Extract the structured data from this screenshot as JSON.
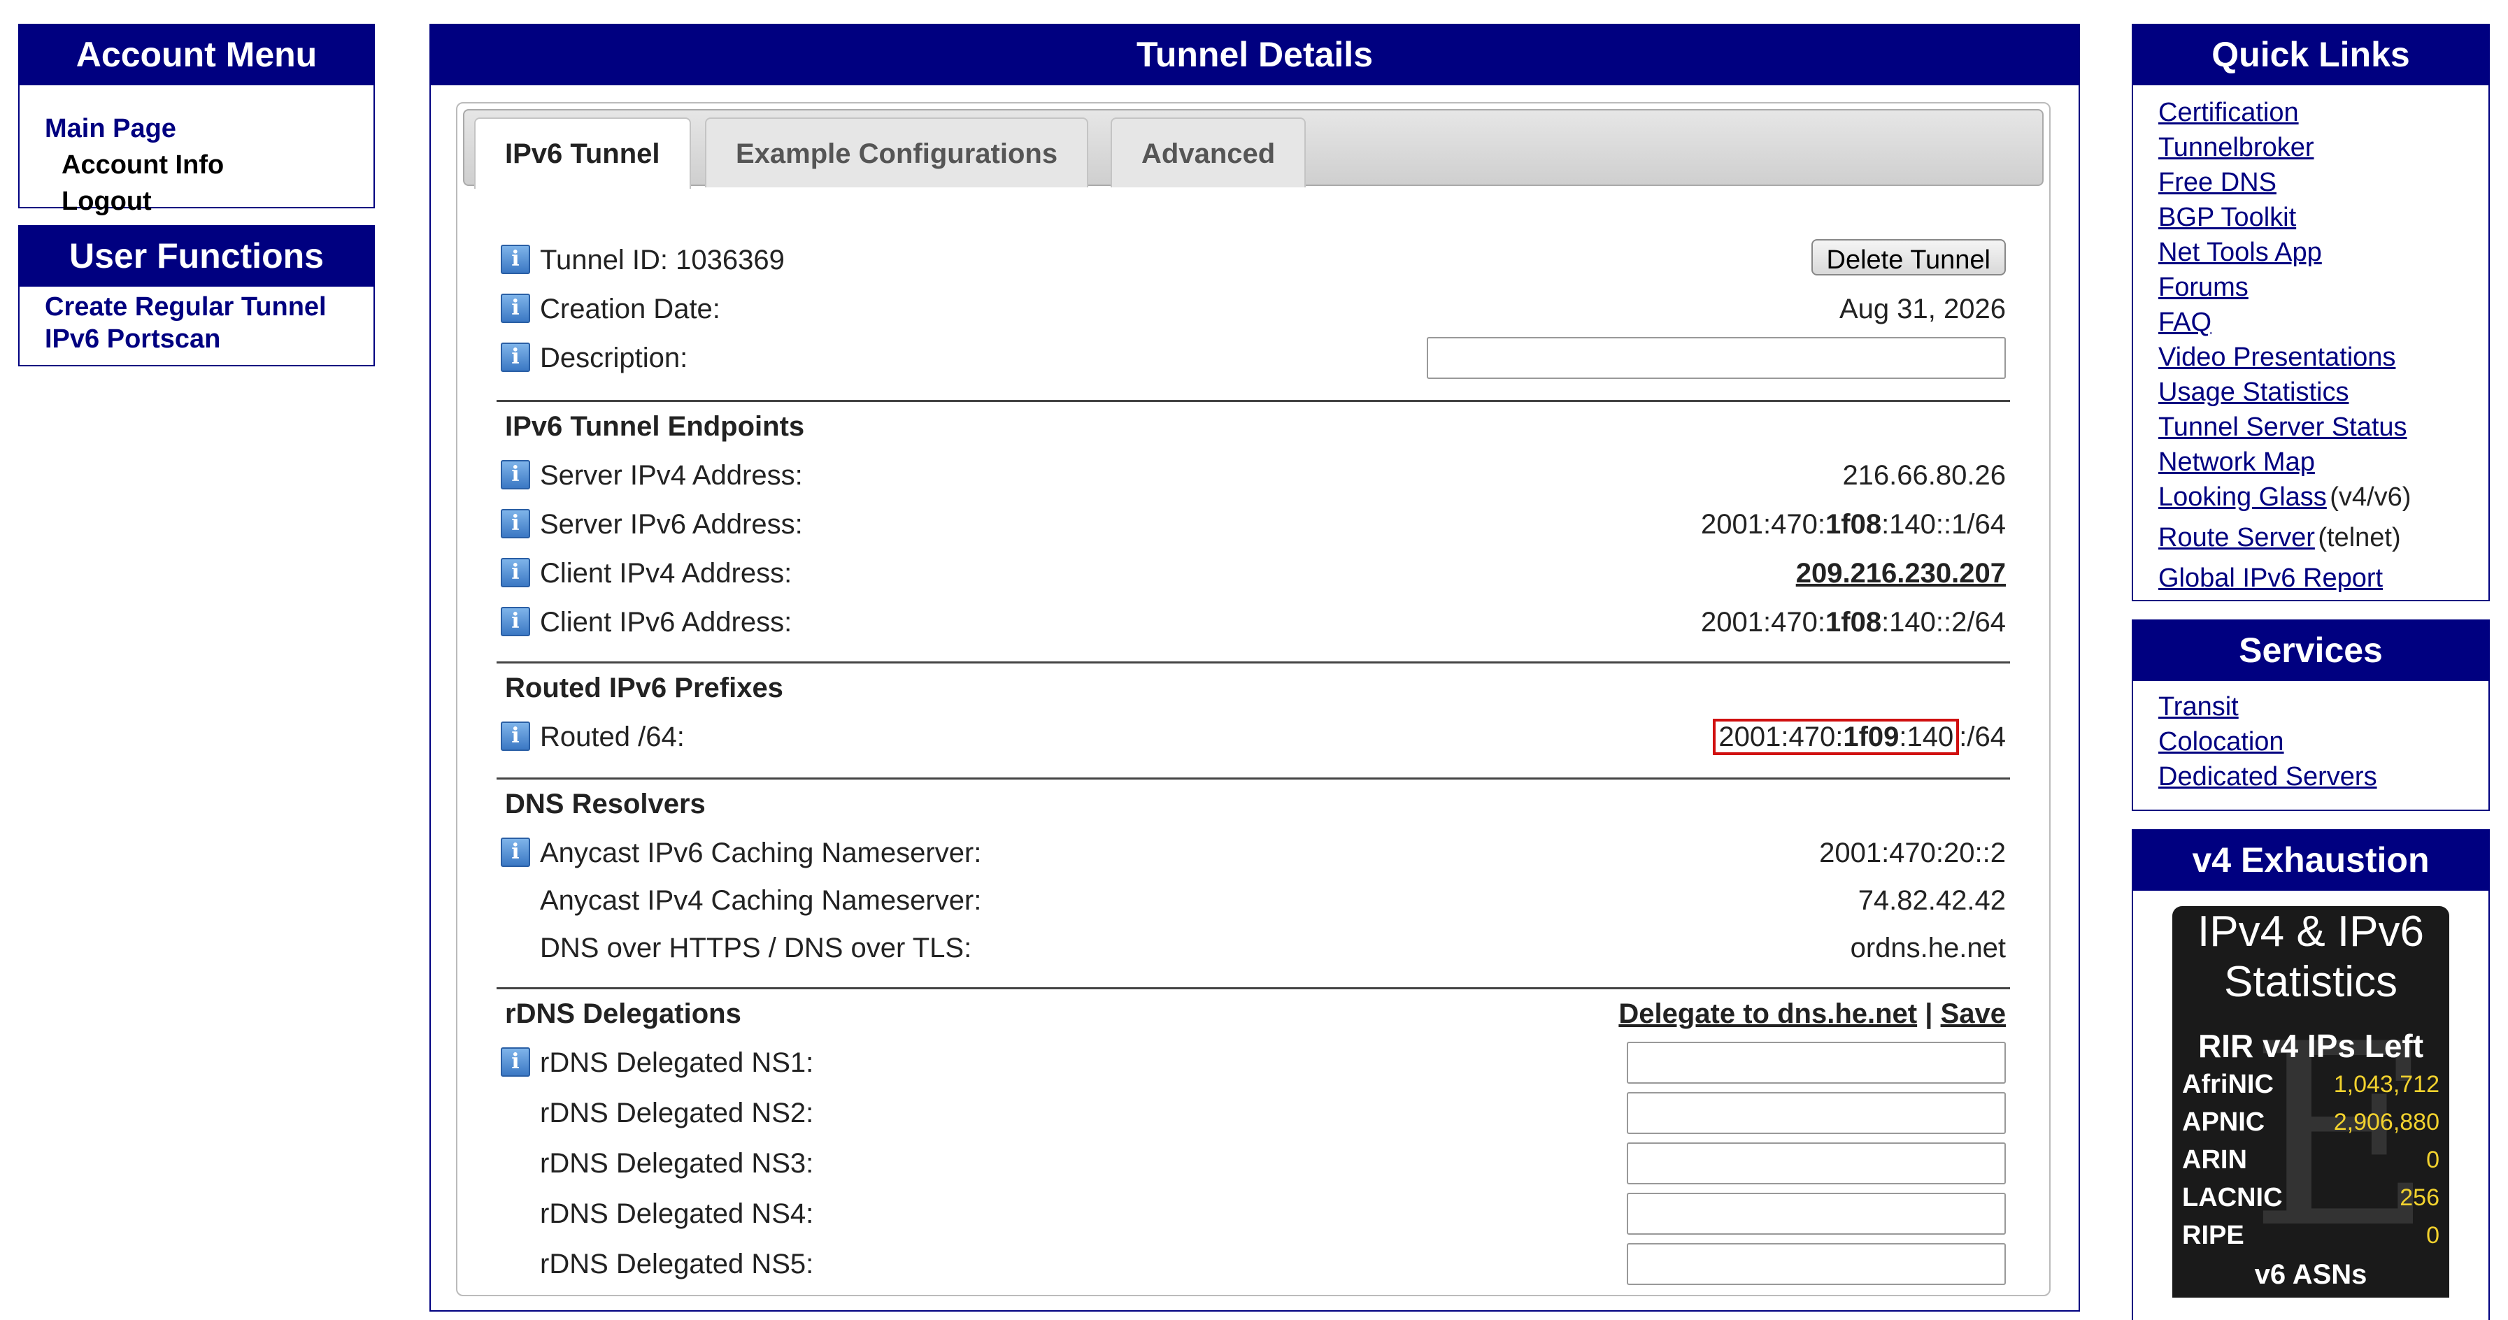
{
  "account_menu": {
    "title": "Account Menu",
    "links": [
      "Main Page",
      "Account Info",
      "Logout"
    ]
  },
  "user_functions": {
    "title": "User Functions",
    "links": [
      "Create Regular Tunnel",
      "IPv6 Portscan"
    ]
  },
  "tunnel": {
    "title": "Tunnel Details",
    "tabs": [
      "IPv6 Tunnel",
      "Example Configurations",
      "Advanced"
    ],
    "tunnel_id_label": "Tunnel ID: 1036369",
    "delete_button": "Delete Tunnel",
    "creation_date_label": "Creation Date:",
    "creation_date": "Aug 31, 2026",
    "description_label": "Description:",
    "description_value": "",
    "endpoints_heading": "IPv6 Tunnel Endpoints",
    "server_ipv4_label": "Server IPv4 Address:",
    "server_ipv4": "216.66.80.26",
    "server_ipv6_label": "Server IPv6 Address:",
    "server_ipv6": [
      "2001:470:",
      "1f08",
      ":140::1/64"
    ],
    "client_ipv4_label": "Client IPv4 Address:",
    "client_ipv4": "209.216.230.207",
    "client_ipv6_label": "Client IPv6 Address:",
    "client_ipv6": [
      "2001:470:",
      "1f08",
      ":140::2/64"
    ],
    "routed_heading": "Routed IPv6 Prefixes",
    "routed64_label": "Routed /64:",
    "routed64": [
      "2001:470:",
      "1f09",
      ":140",
      ":/64"
    ],
    "dns_heading": "DNS Resolvers",
    "anycast_v6_label": "Anycast IPv6 Caching Nameserver:",
    "anycast_v6": "2001:470:20::2",
    "anycast_v4_label": "Anycast IPv4 Caching Nameserver:",
    "anycast_v4": "74.82.42.42",
    "doh_label": "DNS over HTTPS / DNS over TLS:",
    "doh": "ordns.he.net",
    "rdns_heading": "rDNS Delegations",
    "delegate_link": "Delegate to dns.he.net",
    "separator": "|",
    "save_link": "Save",
    "rdns_labels": [
      "rDNS Delegated NS1:",
      "rDNS Delegated NS2:",
      "rDNS Delegated NS3:",
      "rDNS Delegated NS4:",
      "rDNS Delegated NS5:"
    ]
  },
  "quick_links": {
    "title": "Quick Links",
    "links": [
      "Certification",
      "Tunnelbroker",
      "Free DNS",
      "BGP Toolkit",
      "Net Tools App",
      "Forums",
      "FAQ",
      "Video Presentations",
      "Usage Statistics",
      "Tunnel Server Status",
      "Network Map",
      "Looking Glass",
      "Route Server",
      "Global IPv6 Report"
    ],
    "looking_glass_extra": "(v4/v6)",
    "route_server_extra": "(telnet)"
  },
  "services": {
    "title": "Services",
    "links": [
      "Transit",
      "Colocation",
      "Dedicated Servers"
    ]
  },
  "v4_exhaustion": {
    "title": "v4 Exhaustion",
    "widget_title_1": "IPv4 & IPv6",
    "widget_title_2": "Statistics",
    "subtitle": "RIR v4 IPs Left",
    "rirs": [
      {
        "name": "AfriNIC",
        "value": "1,043,712"
      },
      {
        "name": "APNIC",
        "value": "2,906,880"
      },
      {
        "name": "ARIN",
        "value": "0"
      },
      {
        "name": "LACNIC",
        "value": "256"
      },
      {
        "name": "RIPE",
        "value": "0"
      }
    ],
    "v6_heading": "v6 ASNs"
  },
  "colors": {
    "navy": "#000080",
    "highlight_border": "#d01010",
    "stat_value": "#f2d22e"
  }
}
